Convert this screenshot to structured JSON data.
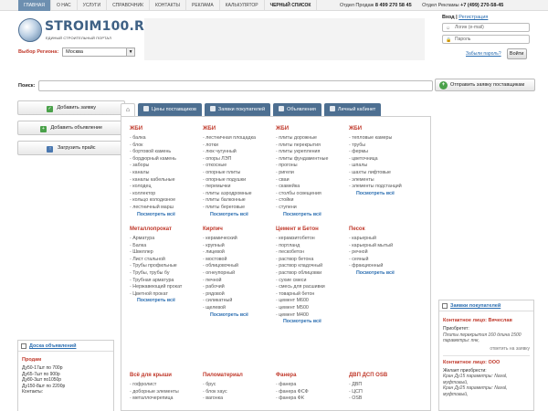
{
  "topnav": {
    "items": [
      "Главная",
      "О нас",
      "Услуги",
      "Справочник",
      "Контакты",
      "Реклама",
      "Калькулятор",
      "Черный список"
    ],
    "active_index": 0
  },
  "phones": {
    "sales_label": "Отдел Продаж",
    "sales_phone": "8 499 270 58 45",
    "ads_label": "Отдел Рекламы",
    "ads_phone": "+7 (499) 270-58-45"
  },
  "logo": {
    "name": "STROIM100.RU",
    "tagline": "ЕДИНЫЙ СТРОИТЕЛЬНЫЙ ПОРТАЛ"
  },
  "region": {
    "label": "Выбор Региона:",
    "value": "Москва"
  },
  "login": {
    "title": "Вход",
    "separator": "|",
    "register": "Регистрация",
    "login_placeholder": "Логин (e-mail)",
    "password_placeholder": "Пароль",
    "forgot": "Забыли пароль?",
    "submit": "Войти"
  },
  "search": {
    "label": "Поиск:",
    "value": ""
  },
  "send_request": "Отправить заявку поставщикам",
  "left_buttons": {
    "add_request": "Добавить заявку",
    "add_ad": "Добавить объявление",
    "upload_price": "Загрузить прайс"
  },
  "tabs": [
    "Цены поставщиков",
    "Заявки покупателей",
    "Объявления",
    "Личный кабинет"
  ],
  "categories": [
    {
      "title": "ЖБИ",
      "items": [
        "балка",
        "блок",
        "бортовой камень",
        "бордюрный камень",
        "заборы",
        "каналы",
        "каналы кабельные",
        "колодец",
        "коллектор",
        "кольцо колодезное",
        "лестничный марш"
      ],
      "more": "Посмотреть всё"
    },
    {
      "title": "ЖБИ",
      "items": [
        "лестничная площадка",
        "лотки",
        "люк чугунный",
        "опоры ЛЭП",
        "откосные",
        "опорные плиты",
        "опорные подушки",
        "перемычки",
        "плиты аэродромные",
        "плиты балконные",
        "плиты береговые"
      ],
      "more": "Посмотреть всё"
    },
    {
      "title": "ЖБИ",
      "items": [
        "плиты дорожные",
        "плиты перекрытия",
        "плиты укрепления",
        "плиты фундаментные",
        "прогоны",
        "ригели",
        "сваи",
        "скамейка",
        "столбы освещения",
        "стойки",
        "ступени"
      ],
      "more": "Посмотреть всё"
    },
    {
      "title": "ЖБИ",
      "items": [
        "тепловые камеры",
        "трубы",
        "фермы",
        "цветочница",
        "шпалы",
        "шахты лифтовые",
        "элементы",
        "элементы подстанций"
      ],
      "more": "Посмотреть всё"
    },
    {
      "title": "Металлопрокат",
      "items": [
        "Арматура",
        "Балка",
        "Швеллер",
        "Лист стальной",
        "Трубы профильные",
        "Трубы, трубы бу",
        "Трубная арматура",
        "Нержавеющий прокат",
        "Цветной прокат"
      ],
      "more": "Посмотреть всё"
    },
    {
      "title": "Кирпич",
      "items": [
        "керамический",
        "крупный",
        "лицевой",
        "мостовой",
        "облицовочный",
        "огнеупорный",
        "печной",
        "рабочий",
        "рядовой",
        "силикатный",
        "щелевой"
      ],
      "more": "Посмотреть всё"
    },
    {
      "title": "Цемент и Бетон",
      "items": [
        "керамзитобетон",
        "портланд",
        "пескобетон",
        "раствор бетона",
        "раствор кладочный",
        "раствор облицовки",
        "сухие смеси",
        "смесь для расшивки",
        "товарный бетон",
        "цемент М600",
        "цемент М500",
        "цемент М400"
      ],
      "more": "Посмотреть всё"
    },
    {
      "title": "Песок",
      "items": [
        "карьерный",
        "карьерный мытый",
        "речной",
        "сеяный",
        "фракционный"
      ],
      "more": "Посмотреть всё"
    },
    {
      "title": "Всё для крыши",
      "items": [
        "гофролист",
        "доборные элементы",
        "металлочерепица"
      ],
      "more": ""
    },
    {
      "title": "Пиломатериал",
      "items": [
        "брус",
        "блок хаус",
        "вагонка"
      ],
      "more": ""
    },
    {
      "title": "Фанера",
      "items": [
        "фанера",
        "фанера ФСФ",
        "фанера ФК"
      ],
      "more": ""
    },
    {
      "title": "ДВП ДСП OSB",
      "items": [
        "ДВП",
        "ЦСП",
        "OSB"
      ],
      "more": ""
    }
  ],
  "buyer_requests": {
    "title": "Заявки покупателей",
    "entries": [
      {
        "contact": "Контактное лицо: Вячеслав",
        "lines": [
          "Приобретет:",
          "Плиты перекрытия 160 длина 1500 параметры: пнк,"
        ],
        "answer": "ответить на заявку"
      },
      {
        "contact": "Контактное лицо: ООО",
        "lines": [
          "Желает приобрести:",
          "Кран Дy15 параметры: Naval, муфтовый,",
          "Кран Дy25 параметры: Naval, муфтовый,"
        ],
        "answer": ""
      }
    ]
  },
  "ads_board": {
    "title": "Доска объявлений",
    "subtitle": "Продам",
    "lines": [
      "Ду50-17шт по 700р",
      "Ду65-7шт по 900р",
      "Ду80-3шт по1050р",
      "Ду150-8шт по 2200р"
    ],
    "contacts_label": "Контакты:"
  }
}
